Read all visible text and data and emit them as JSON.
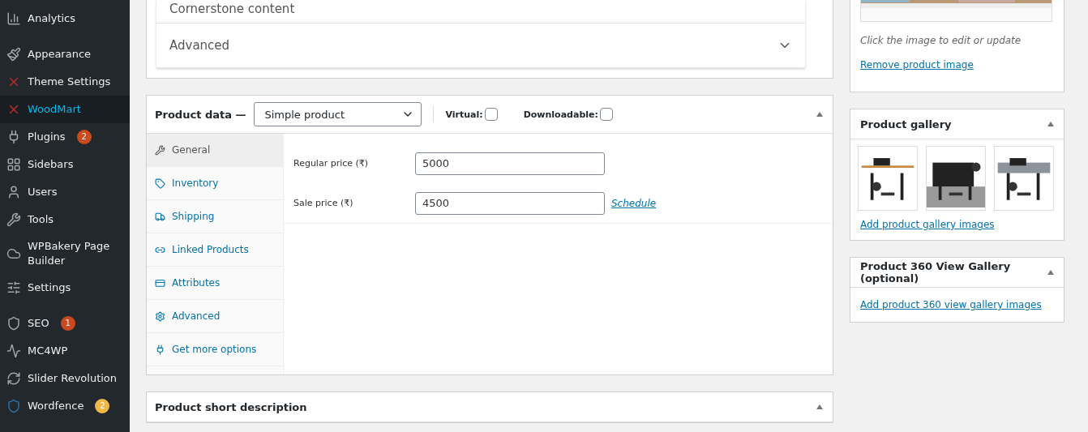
{
  "sidebar": {
    "items": [
      {
        "label": "Analytics",
        "selected": false
      },
      {
        "label": "Appearance",
        "selected": false
      },
      {
        "label": "Theme Settings",
        "selected": false
      },
      {
        "label": "WoodMart",
        "selected": true
      },
      {
        "label": "Plugins",
        "selected": false,
        "badge": "2",
        "color": "#ca4a1f"
      },
      {
        "label": "Sidebars",
        "selected": false
      },
      {
        "label": "Users",
        "selected": false
      },
      {
        "label": "Tools",
        "selected": false
      },
      {
        "label": "WPBakery Page Builder",
        "selected": false
      },
      {
        "label": "Settings",
        "selected": false
      },
      {
        "label": "SEO",
        "selected": false,
        "badge": "1",
        "color": "#ca4a1f"
      },
      {
        "label": "MC4WP",
        "selected": false
      },
      {
        "label": "Slider Revolution",
        "selected": false
      },
      {
        "label": "Wordfence",
        "selected": false,
        "badge": "2",
        "color": "#f0b849"
      }
    ]
  },
  "seo_box": {
    "rows": [
      {
        "label": "Cornerstone content"
      },
      {
        "label": "Advanced",
        "expanded": false
      }
    ]
  },
  "product_data": {
    "title": "Product data —",
    "type_select": "Simple product",
    "options": [
      {
        "label": "Virtual:",
        "checked": false
      },
      {
        "label": "Downloadable:",
        "checked": false
      }
    ],
    "tabs": [
      {
        "label": "General",
        "selected": true
      },
      {
        "label": "Inventory",
        "selected": false
      },
      {
        "label": "Shipping",
        "selected": false
      },
      {
        "label": "Linked Products",
        "selected": false
      },
      {
        "label": "Attributes",
        "selected": false
      },
      {
        "label": "Advanced",
        "selected": false
      },
      {
        "label": "Get more options",
        "selected": false
      }
    ],
    "fields": [
      {
        "label": "Regular price (₹)",
        "value": "5000"
      },
      {
        "label": "Sale price (₹)",
        "value": "4500",
        "link": "Schedule"
      }
    ]
  },
  "short_description": {
    "title": "Product short description"
  },
  "product_image": {
    "hint": "Click the image to edit or update",
    "link": "Remove product image"
  },
  "gallery": {
    "title": "Product gallery",
    "link": "Add product gallery images"
  },
  "gallery_360": {
    "title": "Product 360 View Gallery (optional)",
    "link": "Add product 360 view gallery images"
  }
}
